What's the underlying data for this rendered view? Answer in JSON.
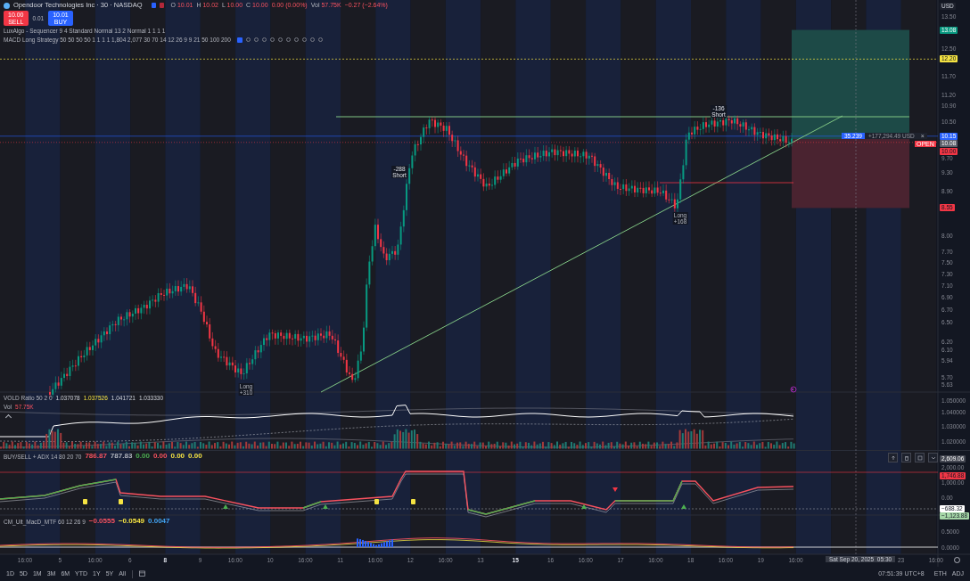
{
  "header": {
    "symbol": "Opendoor Technologies Inc · 30 · NASDAQ",
    "ohlc": [
      {
        "key": "O",
        "value": "10.01"
      },
      {
        "key": "H",
        "value": "10.02"
      },
      {
        "key": "L",
        "value": "10.00"
      },
      {
        "key": "C",
        "value": "10.00"
      }
    ],
    "change": "0.00 (0.00%)",
    "volume_label": "Vol",
    "volume": "57.75K",
    "volume_change": "−0.27 (−2.64%)"
  },
  "trade": {
    "sell": {
      "price": "10.00",
      "label": "SELL"
    },
    "spread": "0.01",
    "buy": {
      "price": "10.01",
      "label": "BUY"
    }
  },
  "indicators": [
    "LuxAlgo - Sequencer 9 4 Standard Normal 13 2 Normal 1 1 1 1",
    "MACD Long Strategy 50 50 50 50 1 1 1 1 1,804 2,077 30 70 14 12 26 9 9 21 50 100 200"
  ],
  "price_axis": {
    "currency": "USD",
    "ticks": [
      "13.50",
      "12.50",
      "11.70",
      "11.20",
      "10.90",
      "10.50",
      "9.70",
      "9.30",
      "8.90",
      "8.00",
      "7.70",
      "7.50",
      "7.30",
      "7.10",
      "6.90",
      "6.70",
      "6.50",
      "6.20",
      "6.10",
      "5.94",
      "5.70",
      "5.63"
    ],
    "badges": [
      {
        "value": "13.08",
        "color": "#089981"
      },
      {
        "value": "12.20",
        "color": "#f5e342"
      },
      {
        "value": "10.15",
        "color": "#2962ff"
      },
      {
        "value": "10.08",
        "color": "#5d606b"
      },
      {
        "value": "10.00",
        "color": "#f23645"
      },
      {
        "value": "8.55",
        "color": "#f23645"
      }
    ],
    "open_label": "OPEN"
  },
  "position": {
    "quantity": "35.239",
    "pnl": "+177,294.49 USD",
    "close": "×"
  },
  "annotations": [
    {
      "kind": "long",
      "lines": [
        "Long",
        "+310"
      ]
    },
    {
      "kind": "short",
      "lines": [
        "-288",
        "Short"
      ]
    },
    {
      "kind": "long",
      "lines": [
        "Long",
        "+168"
      ]
    },
    {
      "kind": "short",
      "lines": [
        "-136",
        "Short"
      ]
    }
  ],
  "vold": {
    "legend": "VOLD Ratio 50 2 0",
    "values": [
      "1.037078",
      "1.037526",
      "1.041721",
      "1.033330"
    ],
    "vol_label": "Vol",
    "vol": "57.75K",
    "ticks": [
      "1.050000",
      "1.040000",
      "1.030000",
      "1.020000"
    ]
  },
  "buysell": {
    "legend": "BUY/SELL + ADX 14 80 20 70",
    "values": [
      {
        "text": "786.87",
        "color": "#f7525f"
      },
      {
        "text": "787.83",
        "color": "#b2b5be"
      },
      {
        "text": "0.00",
        "color": "#4caf50"
      },
      {
        "text": "0.00",
        "color": "#f7525f"
      },
      {
        "text": "0.00",
        "color": "#f5e342"
      },
      {
        "text": "0.00",
        "color": "#f5e342"
      }
    ],
    "ticks": [
      "2,000.00",
      "1,000.00",
      "0.00"
    ],
    "badges": [
      {
        "value": "2,609.06",
        "color": "#434651"
      },
      {
        "value": "1,746.88",
        "color": "#f23645"
      },
      {
        "value": "−688.32",
        "color": "#ffffff"
      },
      {
        "value": "−1,123.88",
        "color": "#a5d6a7"
      }
    ]
  },
  "macd": {
    "legend": "CM_Ult_MacD_MTF 60 12 26 9",
    "values": [
      {
        "text": "−0.0555",
        "color": "#f7525f"
      },
      {
        "text": "−0.0549",
        "color": "#f5e342"
      },
      {
        "text": "0.0047",
        "color": "#42a5f5"
      }
    ],
    "ticks": [
      "0.5000",
      "0.0000"
    ]
  },
  "time_axis": {
    "labels": [
      {
        "text": "16:00",
        "bold": false
      },
      {
        "text": "5",
        "bold": false
      },
      {
        "text": "16:00",
        "bold": false
      },
      {
        "text": "6",
        "bold": false
      },
      {
        "text": "8",
        "bold": true
      },
      {
        "text": "9",
        "bold": false
      },
      {
        "text": "16:00",
        "bold": false
      },
      {
        "text": "10",
        "bold": false
      },
      {
        "text": "16:00",
        "bold": false
      },
      {
        "text": "11",
        "bold": false
      },
      {
        "text": "16:00",
        "bold": false
      },
      {
        "text": "12",
        "bold": false
      },
      {
        "text": "16:00",
        "bold": false
      },
      {
        "text": "13",
        "bold": false
      },
      {
        "text": "15",
        "bold": true
      },
      {
        "text": "16",
        "bold": false
      },
      {
        "text": "16:00",
        "bold": false
      },
      {
        "text": "17",
        "bold": false
      },
      {
        "text": "16:00",
        "bold": false
      },
      {
        "text": "18",
        "bold": false
      },
      {
        "text": "16:00",
        "bold": false
      },
      {
        "text": "19",
        "bold": false
      },
      {
        "text": "16:00",
        "bold": false
      },
      {
        "text": "23",
        "bold": false
      },
      {
        "text": "16:00",
        "bold": false
      }
    ],
    "crosshair": "Sat Sep 20, 2025  05:30"
  },
  "toolbar": {
    "ranges": [
      "1D",
      "5D",
      "1M",
      "3M",
      "6M",
      "YTD",
      "1Y",
      "5Y",
      "All"
    ],
    "time": "07:51:39 UTC+8",
    "session": "ETH",
    "adjust": "ADJ"
  }
}
